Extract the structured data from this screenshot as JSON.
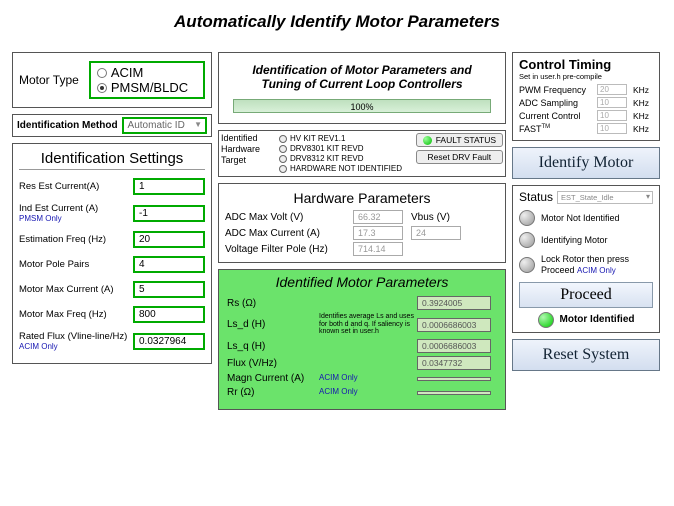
{
  "title": "Automatically Identify Motor Parameters",
  "motor_type": {
    "label": "Motor Type",
    "options": {
      "acim": "ACIM",
      "pmsm": "PMSM/BLDC"
    },
    "selected": "pmsm"
  },
  "id_method": {
    "label": "Identification Method",
    "value": "Automatic ID"
  },
  "settings": {
    "title": "Identification Settings",
    "res_est": {
      "label": "Res Est Current(A)",
      "value": "1"
    },
    "ind_est": {
      "label": "Ind Est Current (A)",
      "sub": "PMSM Only",
      "value": "-1"
    },
    "est_freq": {
      "label": "Estimation Freq (Hz)",
      "value": "20"
    },
    "pole_pairs": {
      "label": "Motor Pole Pairs",
      "value": "4"
    },
    "max_current": {
      "label": "Motor Max Current (A)",
      "value": "5"
    },
    "max_freq": {
      "label": "Motor Max Freq (Hz)",
      "value": "800"
    },
    "rated_flux": {
      "label": "Rated Flux (Vline-line/Hz)",
      "sub": "ACIM Only",
      "value": "0.0327964"
    }
  },
  "center_top": {
    "heading": "Identification of Motor Parameters and Tuning of Current Loop Controllers",
    "progress": "100%"
  },
  "hw": {
    "label": "Identified Hardware Target",
    "items": [
      "HV KIT REV1.1",
      "DRV8301 KIT REVD",
      "DRV8312 KIT REVD",
      "HARDWARE NOT IDENTIFIED"
    ],
    "fault_btn": "FAULT STATUS",
    "reset_btn": "Reset DRV Fault"
  },
  "hp": {
    "title": "Hardware Parameters",
    "adc_volt": {
      "label": "ADC Max Volt (V)",
      "value": "66.32"
    },
    "vbus": {
      "label": "Vbus (V)",
      "value": "24"
    },
    "adc_curr": {
      "label": "ADC Max Current (A)",
      "value": "17.3"
    },
    "vfp": {
      "label": "Voltage Filter Pole (Hz)",
      "value": "714.14"
    }
  },
  "imp": {
    "title": "Identified Motor Parameters",
    "rs": {
      "label": "Rs (Ω)",
      "value": "0.3924005"
    },
    "lsd": {
      "label": "Ls_d (H)",
      "note": "Identifies average Ls and uses for both d and q. If saliency is known set in user.h",
      "value": "0.0006686003"
    },
    "lsq": {
      "label": "Ls_q (H)",
      "value": "0.0006686003"
    },
    "flux": {
      "label": "Flux (V/Hz)",
      "value": "0.0347732"
    },
    "magn": {
      "label": "Magn Current (A)",
      "acim": "ACIM Only",
      "value": ""
    },
    "rr": {
      "label": "Rr (Ω)",
      "acim": "ACIM Only",
      "value": ""
    }
  },
  "ct": {
    "title": "Control Timing",
    "sub": "Set in user.h pre-compile",
    "pwm": {
      "label": "PWM Frequency",
      "value": "20",
      "unit": "KHz"
    },
    "adc": {
      "label": "ADC Sampling",
      "value": "10",
      "unit": "KHz"
    },
    "cc": {
      "label": "Current Control",
      "value": "10",
      "unit": "KHz"
    },
    "fast": {
      "label": "FAST",
      "value": "10",
      "unit": "KHz"
    }
  },
  "identify_btn": "Identify Motor",
  "status": {
    "label": "Status",
    "state": "EST_State_Idle",
    "s1": "Motor Not Identified",
    "s2": "Identifying Motor",
    "s3": "Lock Rotor then press Proceed",
    "s3_sub": "ACIM Only",
    "proceed": "Proceed",
    "s4": "Motor Identified"
  },
  "reset_btn": "Reset System"
}
